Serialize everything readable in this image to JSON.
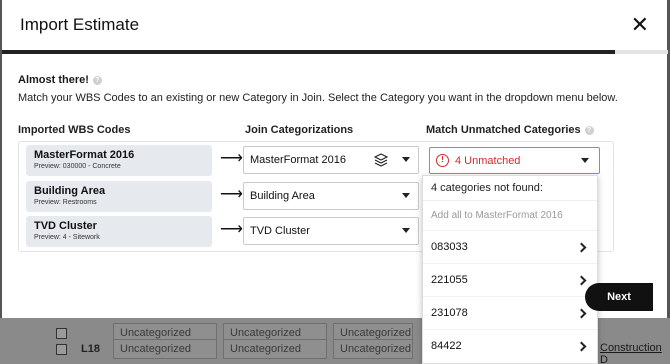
{
  "modal": {
    "title": "Import Estimate",
    "progress": 0.92,
    "intro_title": "Almost there!",
    "intro_desc": "Match your WBS Codes to an existing or new Category in Join. Select the Category you want in the dropdown menu below."
  },
  "columns": {
    "imported": "Imported WBS Codes",
    "join": "Join Categorizations",
    "match": "Match Unmatched Categories"
  },
  "rows": [
    {
      "name": "MasterFormat 2016",
      "preview": "Preview: 030000 - Concrete",
      "join": "MasterFormat 2016"
    },
    {
      "name": "Building Area",
      "preview": "Preview: Restrooms",
      "join": "Building Area"
    },
    {
      "name": "TVD Cluster",
      "preview": "Preview: 4 - Sitework",
      "join": "TVD Cluster"
    }
  ],
  "unmatched": {
    "label": "4 Unmatched",
    "icon": "!"
  },
  "dropdown": {
    "header": "4 categories not found:",
    "add_all": "Add all to MasterFormat 2016",
    "items": [
      "083033",
      "221055",
      "231078",
      "84422"
    ]
  },
  "footer": {
    "next": "Next"
  },
  "background": {
    "rows": [
      {
        "code": "",
        "cells": [
          "Uncategorized",
          "Uncategorized",
          "Uncategorized"
        ]
      },
      {
        "code": "L18",
        "cells": [
          "Uncategorized",
          "Uncategorized",
          "Uncategorized"
        ]
      }
    ],
    "link": "Construction D"
  }
}
